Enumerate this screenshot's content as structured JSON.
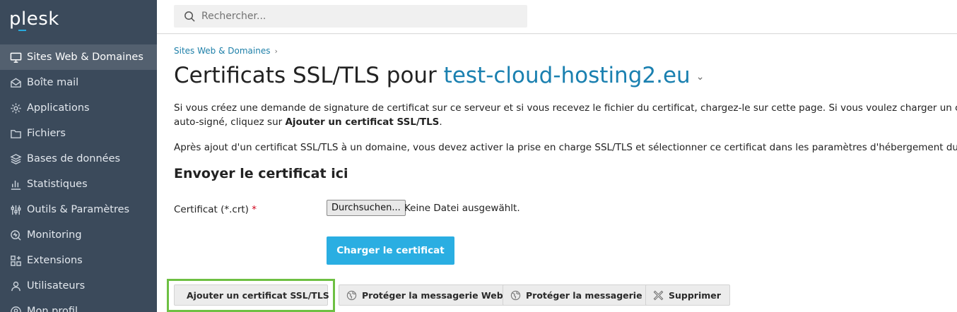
{
  "sidebar": {
    "logo": "plesk",
    "items": [
      {
        "label": "Sites Web & Domaines",
        "icon": "monitor-icon",
        "active": true
      },
      {
        "label": "Boîte mail",
        "icon": "envelope-icon"
      },
      {
        "label": "Applications",
        "icon": "gear-icon"
      },
      {
        "label": "Fichiers",
        "icon": "folder-icon"
      },
      {
        "label": "Bases de données",
        "icon": "database-icon"
      },
      {
        "label": "Statistiques",
        "icon": "bar-chart-icon"
      },
      {
        "label": "Outils & Paramètres",
        "icon": "sliders-icon"
      },
      {
        "label": "Monitoring",
        "icon": "monitoring-icon"
      },
      {
        "label": "Extensions",
        "icon": "extensions-icon"
      },
      {
        "label": "Utilisateurs",
        "icon": "user-icon"
      },
      {
        "label": "Mon profil",
        "icon": "profile-icon"
      }
    ]
  },
  "search": {
    "placeholder": "Rechercher..."
  },
  "breadcrumb": {
    "item": "Sites Web & Domaines"
  },
  "title": {
    "prefix": "Certificats SSL/TLS pour",
    "domain": "test-cloud-hosting2.eu"
  },
  "intro": {
    "line1": "Si vous créez une demande de signature de certificat sur ce serveur et si vous recevez le fichier du certificat, chargez-le sur cette page. Si vous voulez charger un certificat e",
    "line2_prefix": "auto-signé, cliquez sur",
    "line2_bold": "Ajouter un certificat SSL/TLS",
    "line2_suffix": ".",
    "line3": "Après ajout d'un certificat SSL/TLS à un domaine, vous devez activer la prise en charge SSL/TLS et sélectionner ce certificat dans les paramètres d'hébergement du site Web"
  },
  "upload": {
    "heading": "Envoyer le certificat ici",
    "field_label": "Certificat (*.crt)",
    "required_mark": "*",
    "browse_label": "Durchsuchen...",
    "file_status": "Keine Datei ausgewählt.",
    "submit_label": "Charger le certificat"
  },
  "toolbar": {
    "add_label": "Ajouter un certificat SSL/TLS",
    "protect_webmail_label": "Protéger la messagerie Web",
    "protect_mail_label": "Protéger la messagerie",
    "delete_label": "Supprimer"
  },
  "colors": {
    "sidebar": "#3b4a5b",
    "accent": "#2aaee2",
    "link": "#1a80b0",
    "highlight": "#6ec043"
  }
}
